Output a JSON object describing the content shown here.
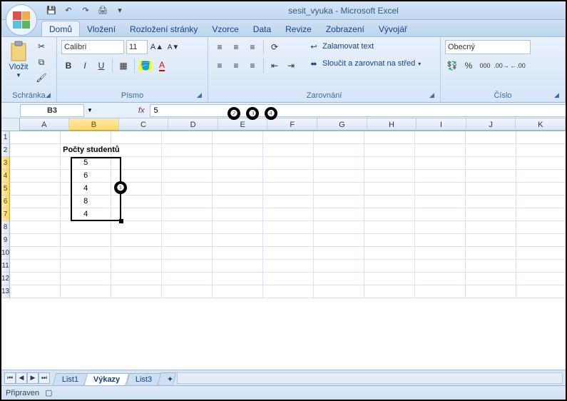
{
  "title": "sesit_vyuka - Microsoft Excel",
  "tabs": {
    "home": "Domů",
    "insert": "Vložení",
    "layout": "Rozložení stránky",
    "formulas": "Vzorce",
    "data": "Data",
    "review": "Revize",
    "view": "Zobrazení",
    "developer": "Vývojář"
  },
  "clipboard": {
    "paste": "Vložit",
    "group": "Schránka"
  },
  "font": {
    "name": "Calibri",
    "size": "11",
    "group": "Písmo"
  },
  "align": {
    "wrap": "Zalamovat text",
    "merge": "Sloučit a zarovnat na střed",
    "group": "Zarovnání"
  },
  "number": {
    "format": "Obecný",
    "group": "Číslo"
  },
  "fbar": {
    "name": "B3",
    "fx": "fx",
    "formula": "5"
  },
  "cols": [
    "A",
    "B",
    "C",
    "D",
    "E",
    "F",
    "G",
    "H",
    "I",
    "J",
    "K"
  ],
  "rownums": [
    "1",
    "2",
    "3",
    "4",
    "5",
    "6",
    "7",
    "8",
    "9",
    "10",
    "11",
    "12",
    "13"
  ],
  "header_cell": "Počty studentů",
  "dataB": {
    "3": "5",
    "4": "6",
    "5": "4",
    "6": "8",
    "7": "4"
  },
  "sheets": {
    "s1": "List1",
    "s2": "Výkazy",
    "s3": "List3"
  },
  "status": {
    "ready": "Připraven"
  },
  "percent": "%",
  "thou": "000"
}
